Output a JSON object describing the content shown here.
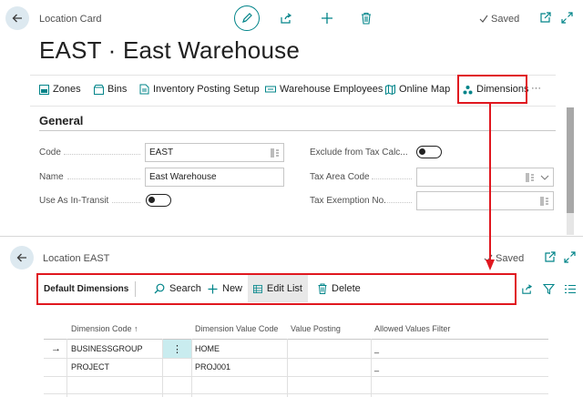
{
  "card": {
    "caption": "Location Card",
    "title": "EAST · East Warehouse",
    "status": "Saved",
    "actions": [
      {
        "label": "Zones",
        "icon": "zones-icon"
      },
      {
        "label": "Bins",
        "icon": "bins-icon"
      },
      {
        "label": "Inventory Posting Setup",
        "icon": "inventory-posting-setup-icon"
      },
      {
        "label": "Warehouse Employees",
        "icon": "warehouse-employees-icon"
      },
      {
        "label": "Online Map",
        "icon": "online-map-icon"
      },
      {
        "label": "Dimensions",
        "icon": "dimensions-icon"
      }
    ],
    "more": "···",
    "section": "General",
    "fields": {
      "code": {
        "label": "Code",
        "value": "EAST"
      },
      "name": {
        "label": "Name",
        "value": "East Warehouse"
      },
      "in_transit": {
        "label": "Use As In-Transit",
        "value": "off"
      },
      "exclude_tax": {
        "label": "Exclude from Tax Calc...",
        "value": "off"
      },
      "tax_area": {
        "label": "Tax Area Code",
        "value": ""
      },
      "tax_exemption": {
        "label": "Tax Exemption No.",
        "value": ""
      }
    }
  },
  "list": {
    "caption": "Location EAST",
    "status": "Saved",
    "toolbar": {
      "title": "Default Dimensions",
      "search": "Search",
      "new": "New",
      "edit_list": "Edit List",
      "delete": "Delete"
    },
    "columns": [
      "Dimension Code ↑",
      "Dimension Value Code",
      "Value Posting",
      "Allowed Values Filter"
    ],
    "rows": [
      {
        "code": "BUSINESSGROUP",
        "value": "HOME",
        "posting": "",
        "filter": "_",
        "row_arrow": "→",
        "menu": "⋮"
      },
      {
        "code": "PROJECT",
        "value": "PROJ001",
        "posting": "",
        "filter": "_"
      }
    ]
  },
  "colors": {
    "accent": "#008489",
    "annotation": "#e0171f",
    "back_button": "#dde9f0",
    "selected_cell": "#c9ecef"
  }
}
